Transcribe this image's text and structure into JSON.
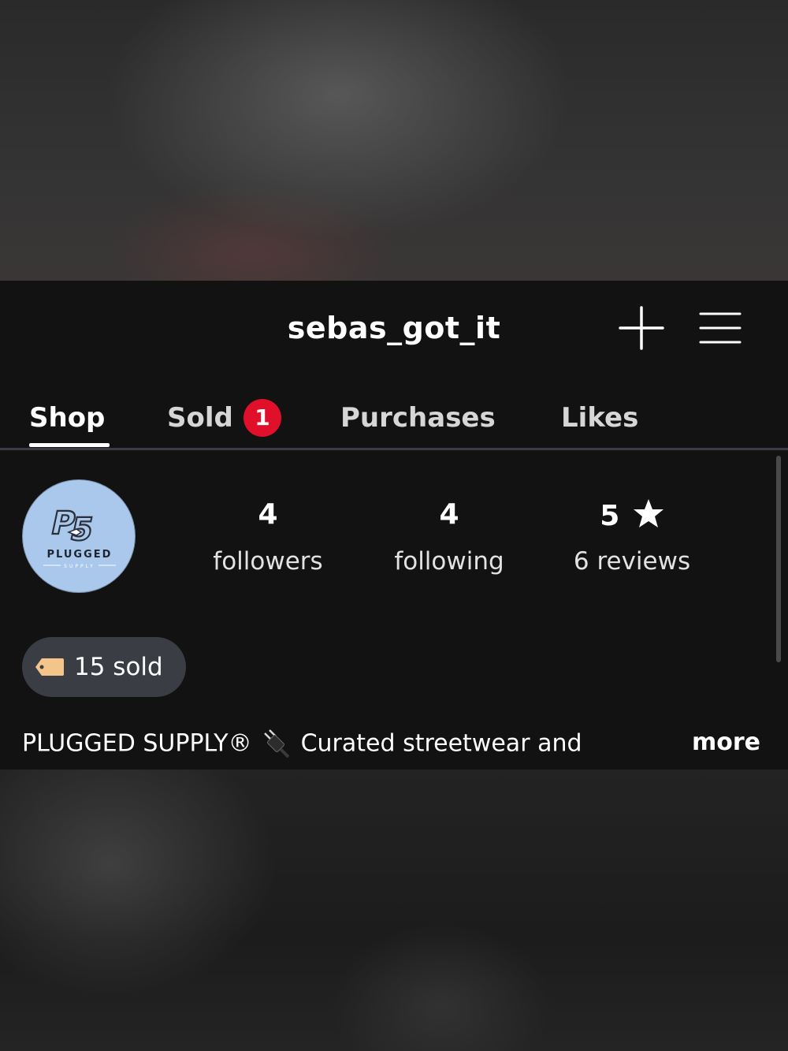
{
  "header": {
    "username": "sebas_got_it",
    "icons": [
      "plus-icon",
      "menu-icon"
    ]
  },
  "tabs": [
    {
      "label": "Shop",
      "active": true
    },
    {
      "label": "Sold",
      "badge": "1"
    },
    {
      "label": "Purchases"
    },
    {
      "label": "Likes"
    }
  ],
  "profile": {
    "avatar_logo_text": "PLUGGED SUPPLY",
    "stats": {
      "followers_value": "4",
      "followers_label": "followers",
      "following_value": "4",
      "following_label": "following",
      "rating_value": "5",
      "rating_icon": "star-icon",
      "reviews_label": "6 reviews"
    },
    "sold_pill": {
      "icon": "tag-icon",
      "text": "15 sold"
    },
    "bio": {
      "brand": "PLUGGED SUPPLY®",
      "icon": "plug-icon",
      "text": "Curated streetwear and",
      "more_label": "more"
    }
  },
  "colors": {
    "panel_bg": "#121212",
    "badge": "#e0102a",
    "avatar_bg": "#a9c8ec",
    "pill_bg": "#3a3d44"
  }
}
